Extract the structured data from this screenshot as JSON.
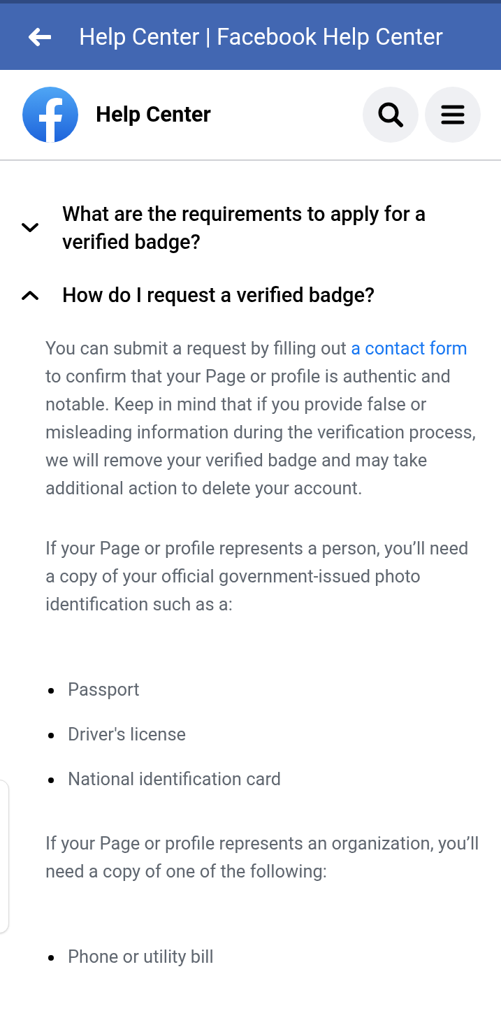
{
  "browser_bar": {
    "title": "Help Center | Facebook Help Center"
  },
  "header": {
    "title": "Help Center"
  },
  "faq": [
    {
      "question": "What are the requirements to apply for a verified badge?",
      "expanded": false
    },
    {
      "question": "How do I request a verified badge?",
      "expanded": true,
      "content": [
        {
          "kind": "paragraph",
          "text": "You can submit a request by filling out",
          "link": "a contact form",
          "text_after": "to confirm that your Page or profile is authentic and notable. Keep in mind that if you provide false or misleading information during the verification process, we will remove your verified badge and may take additional action to delete your account."
        },
        {
          "kind": "paragraph",
          "text": "If your Page or profile represents a person, you’ll need a copy of your official government-issued photo identification such as a:"
        },
        {
          "kind": "list",
          "items": [
            "Passport",
            "Driver's license",
            "National identification card"
          ]
        },
        {
          "kind": "paragraph",
          "text": "If your Page or profile represents an organization, you’ll need a copy of one of the following:"
        },
        {
          "kind": "list",
          "items": [
            "Phone or utility bill"
          ]
        }
      ]
    }
  ]
}
